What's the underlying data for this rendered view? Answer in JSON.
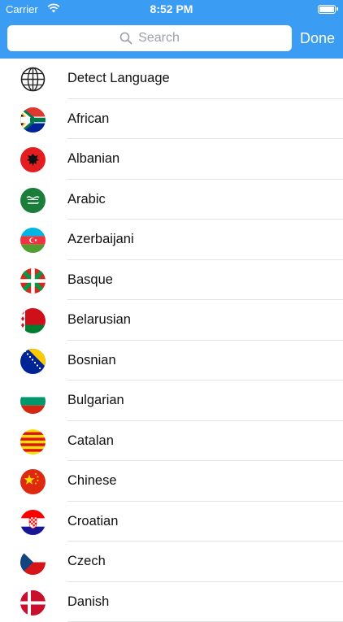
{
  "status_bar": {
    "carrier": "Carrier",
    "time": "8:52 PM"
  },
  "search": {
    "placeholder": "Search",
    "icon": "search-icon"
  },
  "done_label": "Done",
  "languages": [
    {
      "label": "Detect Language",
      "icon": "globe-icon"
    },
    {
      "label": "African",
      "icon": "flag-south-africa-icon"
    },
    {
      "label": "Albanian",
      "icon": "flag-albania-icon"
    },
    {
      "label": "Arabic",
      "icon": "flag-saudi-arabia-icon"
    },
    {
      "label": "Azerbaijani",
      "icon": "flag-azerbaijan-icon"
    },
    {
      "label": "Basque",
      "icon": "flag-basque-icon"
    },
    {
      "label": "Belarusian",
      "icon": "flag-belarus-icon"
    },
    {
      "label": "Bosnian",
      "icon": "flag-bosnia-icon"
    },
    {
      "label": "Bulgarian",
      "icon": "flag-bulgaria-icon"
    },
    {
      "label": "Catalan",
      "icon": "flag-catalonia-icon"
    },
    {
      "label": "Chinese",
      "icon": "flag-china-icon"
    },
    {
      "label": "Croatian",
      "icon": "flag-croatia-icon"
    },
    {
      "label": "Czech",
      "icon": "flag-czech-icon"
    },
    {
      "label": "Danish",
      "icon": "flag-denmark-icon"
    }
  ]
}
